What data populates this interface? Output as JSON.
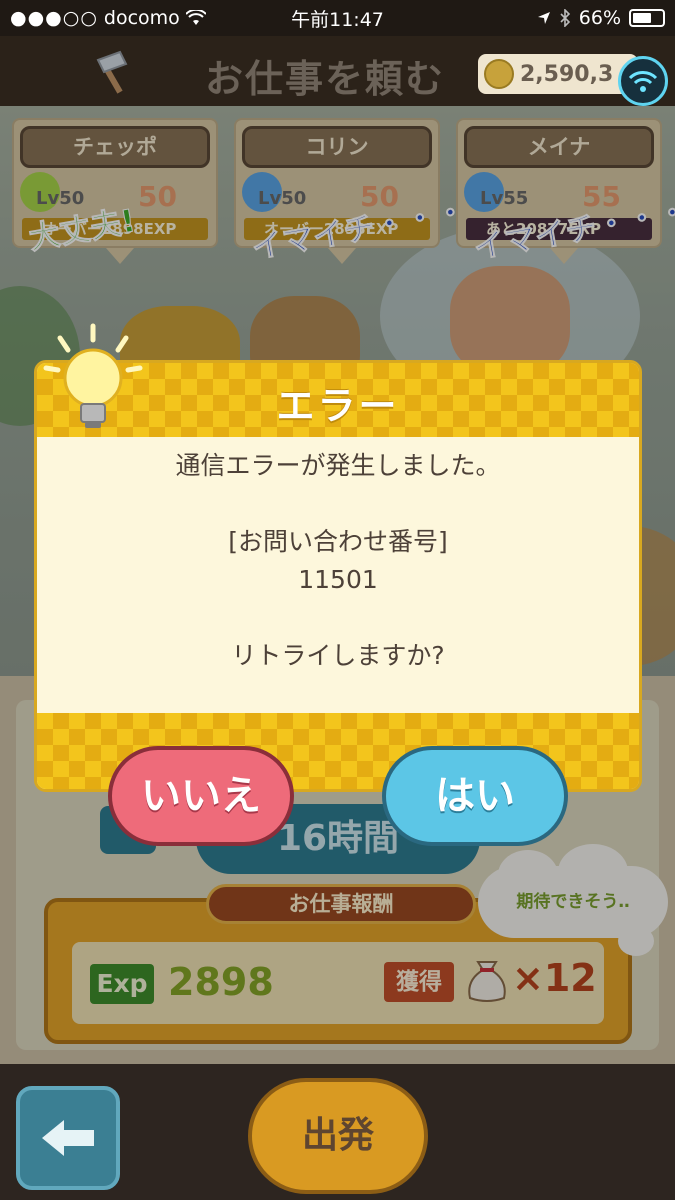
{
  "status_bar": {
    "carrier": "docomo",
    "time": "午前11:47",
    "battery": "66%",
    "battery_level": 0.66
  },
  "header": {
    "title": "お仕事を頼む",
    "coins": "2,590,3"
  },
  "characters": [
    {
      "name": "チェッポ",
      "level": "Lv50",
      "target": "50",
      "mood": "大丈夫!",
      "exp_line": "オーバー2898EXP",
      "mood_color": "#3fae2a"
    },
    {
      "name": "コリン",
      "level": "Lv50",
      "target": "50",
      "mood": "イマイチ・・・",
      "exp_line": "オーバー2898EXP",
      "mood_color": "#2a4fc4"
    },
    {
      "name": "メイナ",
      "level": "Lv55",
      "target": "55",
      "mood": "イマイチ・・・",
      "exp_line": "あと20877EXP",
      "mood_color": "#2a4fc4"
    }
  ],
  "timer": "16時間",
  "reward": {
    "title": "お仕事報酬",
    "exp_label": "Exp",
    "exp_value": "2898",
    "get_label": "獲得",
    "count": "×12"
  },
  "cloud_text": "期待できそう‥",
  "dialog": {
    "title": "エラー",
    "message": "通信エラーが発生しました。",
    "inquiry_label": "[お問い合わせ番号]",
    "inquiry_number": "11501",
    "question": "リトライしますか?",
    "no_label": "いいえ",
    "yes_label": "はい"
  },
  "bottom_nav": {
    "depart_label": "出発"
  },
  "colors": {
    "dialog_gold": "#f3c51c",
    "no_button": "#ee6b7a",
    "yes_button": "#5cc6e6"
  }
}
